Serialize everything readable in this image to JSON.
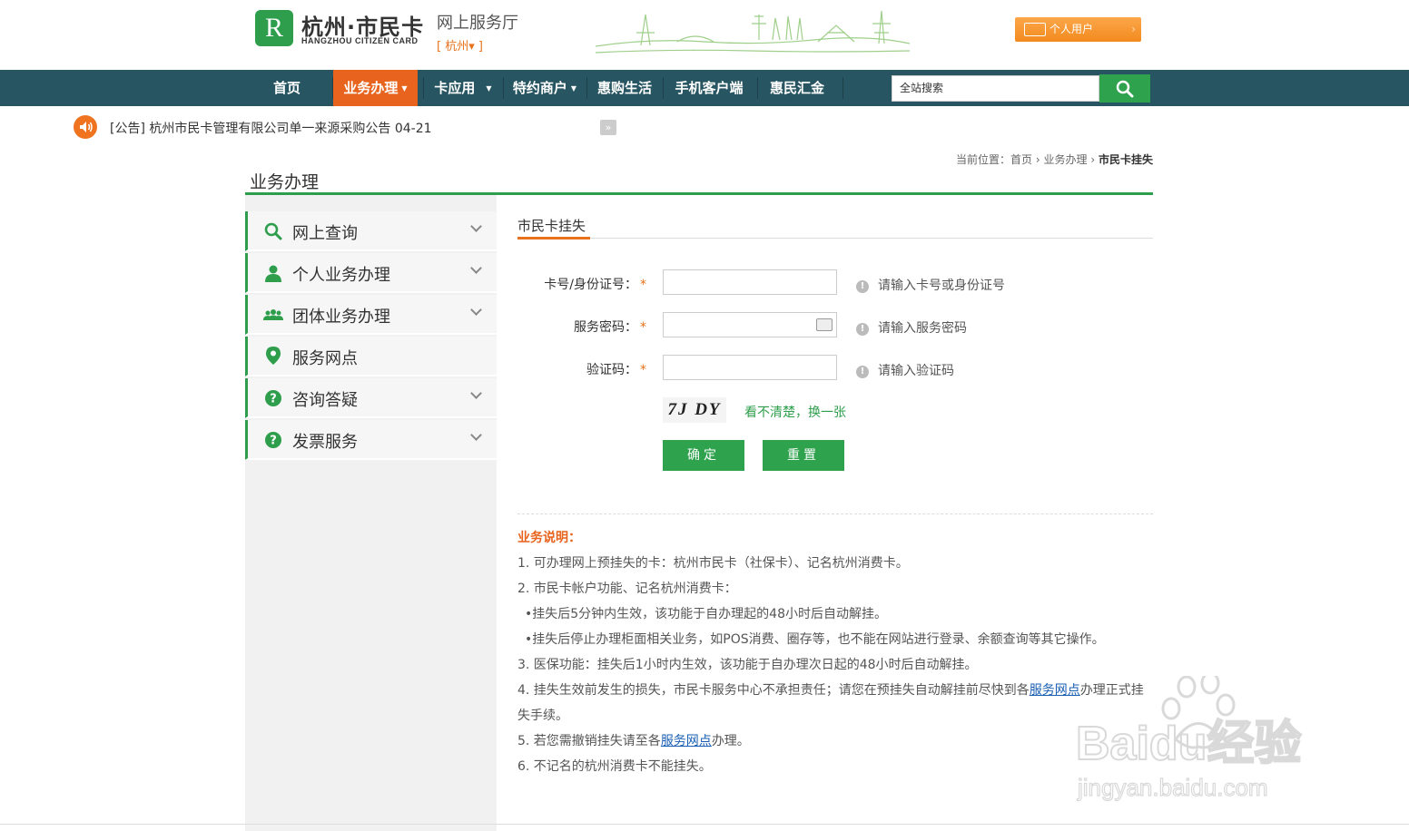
{
  "header": {
    "logo_cn": "杭州·市民卡",
    "logo_en": "HANGZHOU CITIZEN CARD",
    "site_sub": "网上服务厅",
    "city": "[ 杭州▾ ]",
    "personal_user": "个人用户"
  },
  "nav": {
    "items": [
      {
        "label": "首页"
      },
      {
        "label": "业务办理",
        "active": true
      },
      {
        "label": "卡应用"
      },
      {
        "label": "特约商户"
      },
      {
        "label": "惠购生活"
      },
      {
        "label": "手机客户端"
      },
      {
        "label": "惠民汇金"
      }
    ],
    "search_value": "全站搜索"
  },
  "notice": {
    "text": "[公告] 杭州市民卡管理有限公司单一来源采购公告 04-21",
    "next_icon": "»"
  },
  "breadcrumb": {
    "prefix": "当前位置：",
    "home": "首页",
    "sep": "›",
    "section": "业务办理",
    "current": "市民卡挂失"
  },
  "page_title": "业务办理",
  "sidebar": {
    "items": [
      {
        "label": "网上查询",
        "icon": "search-icon"
      },
      {
        "label": "个人业务办理",
        "icon": "person-icon"
      },
      {
        "label": "团体业务办理",
        "icon": "group-icon"
      },
      {
        "label": "服务网点",
        "icon": "location-pin-icon"
      },
      {
        "label": "咨询答疑",
        "icon": "question-icon"
      },
      {
        "label": "发票服务",
        "icon": "question-icon"
      }
    ]
  },
  "form": {
    "title": "市民卡挂失",
    "card_label": "卡号/身份证号：",
    "card_hint": "请输入卡号或身份证号",
    "password_label": "服务密码：",
    "password_hint": "请输入服务密码",
    "captcha_label": "验证码：",
    "captcha_hint": "请输入验证码",
    "required_mark": "*",
    "hint_mark": "!",
    "captcha_text": "7J DY",
    "captcha_refresh": "看不清楚，换一张",
    "submit": "确定",
    "reset": "重置"
  },
  "notes": {
    "title": "业务说明：",
    "n1": "1. 可办理网上预挂失的卡：杭州市民卡（社保卡）、记名杭州消费卡。",
    "n2": "2. 市民卡帐户功能、记名杭州消费卡：",
    "n2a": "•挂失后5分钟内生效，该功能于自办理起的48小时后自动解挂。",
    "n2b": "•挂失后停止办理柜面相关业务，如POS消费、圈存等，也不能在网站进行登录、余额查询等其它操作。",
    "n3": "3. 医保功能：挂失后1小时内生效，该功能于自办理次日起的48小时后自动解挂。",
    "n4_pre": "4. 挂失生效前发生的损失，市民卡服务中心不承担责任；请您在预挂失自动解挂前尽快到各",
    "n4_link": "服务网点",
    "n4_post": "办理正式挂",
    "n4_cont": "失手续。",
    "n5_pre": "5. 若您需撤销挂失请至各",
    "n5_link": "服务网点",
    "n5_post": "办理。",
    "n6": "6. 不记名的杭州消费卡不能挂失。"
  },
  "watermark": {
    "brand": "Baidu经验",
    "url": "jingyan.baidu.com"
  }
}
